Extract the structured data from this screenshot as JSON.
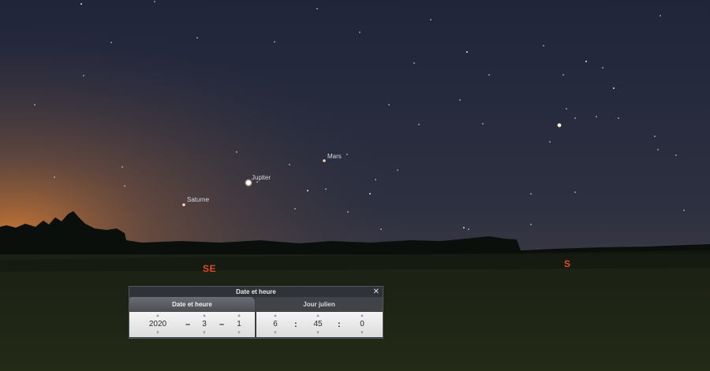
{
  "sky": {
    "planets": [
      {
        "name": "Mars"
      },
      {
        "name": "Jupiter"
      },
      {
        "name": "Saturne"
      }
    ],
    "cardinals": {
      "southeast": "SE",
      "south": "S"
    }
  },
  "dialog": {
    "title": "Date et heure",
    "close_icon": "close-icon",
    "tabs": [
      {
        "label": "Date et heure",
        "active": true
      },
      {
        "label": "Jour julien",
        "active": false
      }
    ],
    "date": {
      "year": "2020",
      "month": "3",
      "day": "1",
      "separator": "–"
    },
    "time": {
      "hour": "6",
      "minute": "45",
      "second": "0",
      "separator": ":"
    }
  }
}
